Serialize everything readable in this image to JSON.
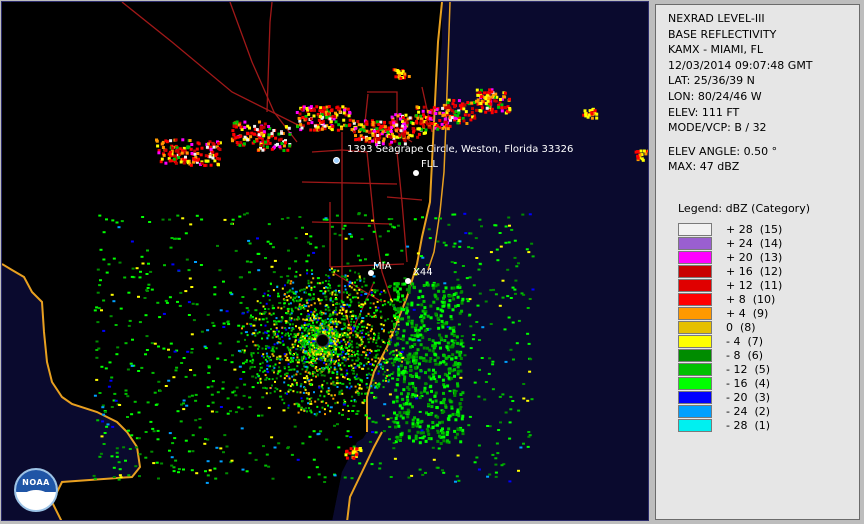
{
  "info": {
    "product": "NEXRAD LEVEL-III",
    "product_type": "BASE REFLECTIVITY",
    "station": "KAMX - MIAMI, FL",
    "datetime": "12/03/2014 09:07:48 GMT",
    "lat": "LAT: 25/36/39 N",
    "lon": "LON: 80/24/46 W",
    "elev": "ELEV: 111 FT",
    "mode": "MODE/VCP: B / 32",
    "elev_angle": "ELEV ANGLE: 0.50 °",
    "max": "MAX: 47 dBZ"
  },
  "legend": {
    "title": "Legend: dBZ (Category)",
    "items": [
      {
        "label": "+ 28  (15)",
        "color": "#f2f2f2"
      },
      {
        "label": "+ 24  (14)",
        "color": "#9a5fd0"
      },
      {
        "label": "+ 20  (13)",
        "color": "#ff00ff"
      },
      {
        "label": "+ 16  (12)",
        "color": "#c80000"
      },
      {
        "label": "+ 12  (11)",
        "color": "#e00000"
      },
      {
        "label": "+ 8  (10)",
        "color": "#ff0000"
      },
      {
        "label": "+ 4  (9)",
        "color": "#ff9900"
      },
      {
        "label": "0  (8)",
        "color": "#e6c000"
      },
      {
        "label": "- 4  (7)",
        "color": "#ffff00"
      },
      {
        "label": "- 8  (6)",
        "color": "#008c00"
      },
      {
        "label": "- 12  (5)",
        "color": "#00c000"
      },
      {
        "label": "- 16  (4)",
        "color": "#00ff00"
      },
      {
        "label": "- 20  (3)",
        "color": "#0000ff"
      },
      {
        "label": "- 24  (2)",
        "color": "#00a0ff"
      },
      {
        "label": "- 28  (1)",
        "color": "#00f0f0"
      }
    ]
  },
  "map": {
    "address_label": "1393 Seagrape Circle, Weston, Florida 33326",
    "labels": {
      "fll": "FLL",
      "mia": "MIA",
      "x44": "X44"
    },
    "logo_text": "NOAA",
    "colors": {
      "coast": "#e8a020",
      "roads": "#a01818",
      "background": "#000000"
    }
  }
}
